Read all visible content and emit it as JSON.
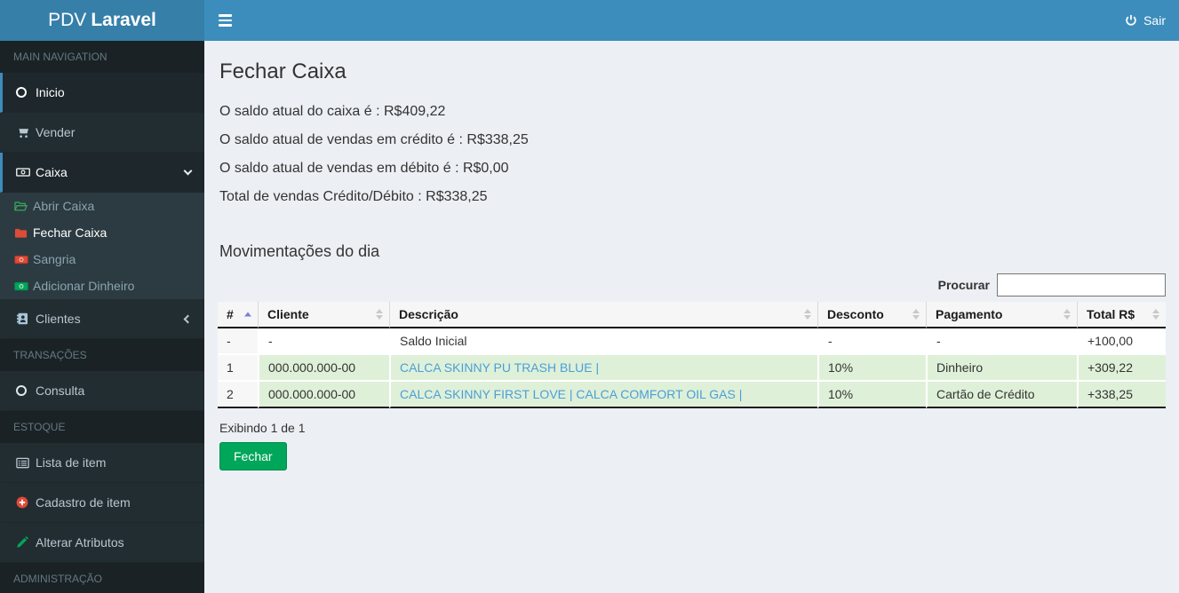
{
  "app": {
    "brand_pre": "PDV",
    "brand_bold": "Laravel",
    "logout_label": "Sair"
  },
  "colors": {
    "navbar": "#3c8dbc",
    "logo_bg": "#367fa9",
    "sidebar": "#222d32",
    "submenu_bg": "#2c3b41",
    "success_row": "#dff0d8",
    "button_green": "#00a65a",
    "danger_icon": "#dd4b39",
    "link": "#4a9fd8"
  },
  "sidebar": {
    "header_main": "MAIN NAVIGATION",
    "inicio": "Inicio",
    "vender": "Vender",
    "caixa": "Caixa",
    "abrir_caixa": "Abrir Caixa",
    "fechar_caixa": "Fechar Caixa",
    "sangria": "Sangria",
    "adicionar_dinheiro": "Adicionar Dinheiro",
    "clientes": "Clientes",
    "header_transacoes": "TRANSAÇÕES",
    "consulta": "Consulta",
    "header_estoque": "ESTOQUE",
    "lista_item": "Lista de item",
    "cadastro_item": "Cadastro de item",
    "alterar_atributos": "Alterar Atributos",
    "header_admin": "ADMINISTRAÇÃO"
  },
  "main": {
    "title": "Fechar Caixa",
    "saldo_caixa": "O saldo atual do caixa é : R$409,22",
    "saldo_credito": "O saldo atual de vendas em crédito é : R$338,25",
    "saldo_debito": "O saldo atual de vendas em débito é : R$0,00",
    "total_vendas": "Total de vendas Crédito/Débito : R$338,25",
    "movements_title": "Movimentações do dia",
    "search_label": "Procurar",
    "search_value": "",
    "table": {
      "headers": [
        "#",
        "Cliente",
        "Descrição",
        "Desconto",
        "Pagamento",
        "Total R$"
      ],
      "rows": [
        {
          "num": "-",
          "cliente": "-",
          "descricao": "Saldo Inicial",
          "desconto": "-",
          "pagamento": "-",
          "total": "+100,00"
        },
        {
          "num": "1",
          "cliente": "000.000.000-00",
          "descricao": "CALCA SKINNY PU TRASH BLUE |",
          "desconto": "10%",
          "pagamento": "Dinheiro",
          "total": "+309,22"
        },
        {
          "num": "2",
          "cliente": "000.000.000-00",
          "descricao": "CALCA SKINNY FIRST LOVE | CALCA COMFORT OIL GAS |",
          "desconto": "10%",
          "pagamento": "Cartão de Crédito",
          "total": "+338,25"
        }
      ]
    },
    "info": "Exibindo 1 de 1",
    "close_button": "Fechar"
  }
}
